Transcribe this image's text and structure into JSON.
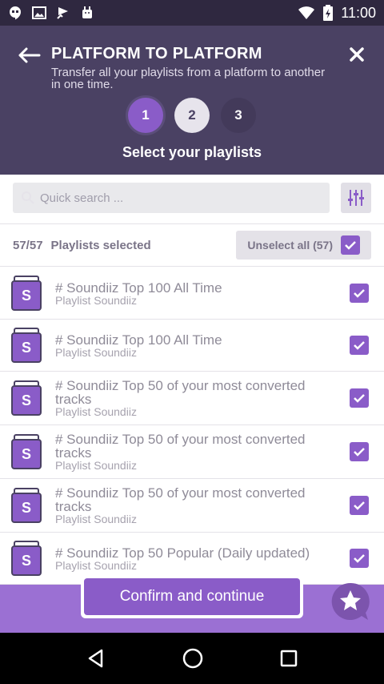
{
  "status_bar": {
    "time": "11:00",
    "left_icons": [
      "hangouts-icon",
      "image-icon",
      "check-flag-icon",
      "android-icon"
    ],
    "right_icons": [
      "wifi-icon",
      "battery-charging-icon"
    ]
  },
  "header": {
    "title": "PLATFORM TO PLATFORM",
    "subtitle": "Transfer all your playlists from a platform to another in one time.",
    "steps": [
      "1",
      "2",
      "3"
    ],
    "active_step": 1,
    "step_title": "Select your playlists"
  },
  "search": {
    "placeholder": "Quick search ..."
  },
  "selection": {
    "count": "57/57",
    "label": "Playlists selected",
    "unselect_label": "Unselect all (57)"
  },
  "playlists": [
    {
      "cover_letter": "S",
      "title": "# Soundiiz Top 100 All Time",
      "subtitle": "Playlist Soundiiz",
      "checked": true
    },
    {
      "cover_letter": "S",
      "title": "# Soundiiz Top 100 All Time",
      "subtitle": "Playlist Soundiiz",
      "checked": true
    },
    {
      "cover_letter": "S",
      "title": "# Soundiiz Top 50 of your most converted tracks",
      "subtitle": "Playlist Soundiiz",
      "checked": true
    },
    {
      "cover_letter": "S",
      "title": "# Soundiiz Top 50 of your most converted tracks",
      "subtitle": "Playlist Soundiiz",
      "checked": true
    },
    {
      "cover_letter": "S",
      "title": "# Soundiiz Top 50 of your most converted tracks",
      "subtitle": "Playlist Soundiiz",
      "checked": true
    },
    {
      "cover_letter": "S",
      "title": "# Soundiiz Top 50 Popular (Daily updated)",
      "subtitle": "Playlist Soundiiz",
      "checked": true
    }
  ],
  "footer": {
    "confirm_label": "Confirm and continue"
  },
  "colors": {
    "header_bg": "#4a4163",
    "accent": "#8a5cc8",
    "bottom_bar": "#9b70d3"
  }
}
